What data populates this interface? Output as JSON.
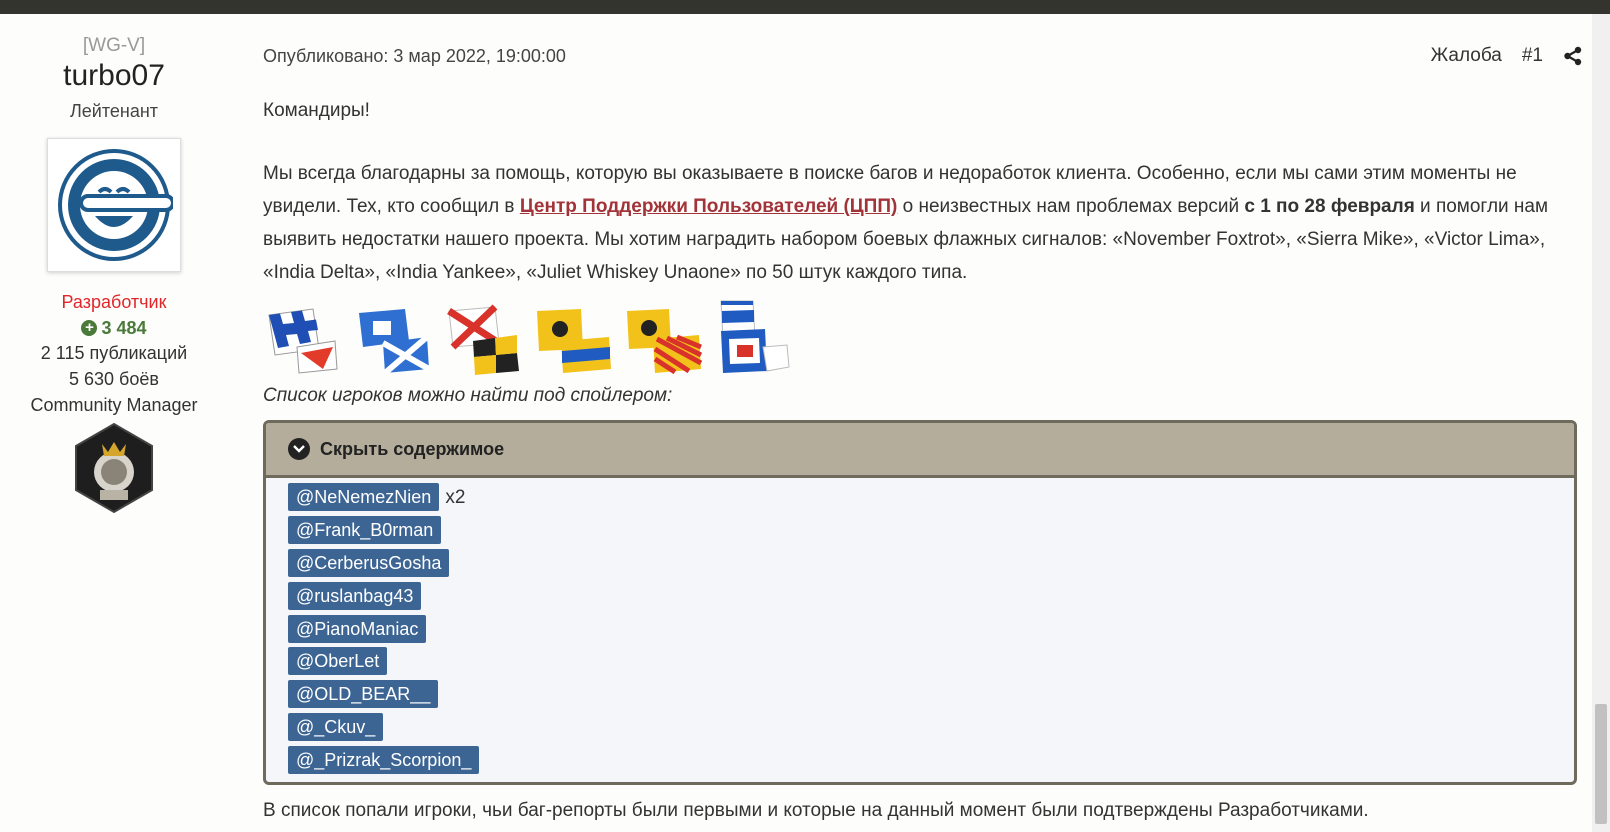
{
  "author": {
    "clan": "[WG-V]",
    "nickname": "turbo07",
    "rank": "Лейтенант",
    "group": "Разработчик",
    "reputation": "3 484",
    "posts": "2 115 публикаций",
    "battles": "5 630 боёв",
    "title": "Community Manager",
    "avatar_icon": "laughing-man-icon",
    "badge_icon": "astronaut-badge-icon"
  },
  "post": {
    "published": "Опубликовано: 3 мар 2022, 19:00:00",
    "report_label": "Жалоба",
    "post_number": "#1",
    "greeting": "Командиры!",
    "paragraph": {
      "part1": "Мы всегда благодарны за помощь, которую вы оказываете в поиске багов и недоработок клиента. Особенно, если мы сами этим моменты не увидели. Тех, кто сообщил в ",
      "link": "Центр Поддержки Пользователей (ЦПП)",
      "part2": " о неизвестных нам проблемах версий ",
      "bold": "с 1 по 28 февраля",
      "part3": " и помогли нам выявить недостатки нашего проекта. Мы хотим наградить набором боевых флажных сигналов: «November Foxtrot», «Sierra Mike», «Victor Lima», «India Delta», «India Yankee», «Juliet Whiskey Unaone» по 50 штук каждого типа."
    },
    "flags": [
      "november-foxtrot-flag-icon",
      "sierra-mike-flag-icon",
      "victor-lima-flag-icon",
      "india-delta-flag-icon",
      "india-yankee-flag-icon",
      "juliet-whiskey-unaone-flag-icon"
    ],
    "spoiler_intro": "Список игроков можно найти под спойлером:",
    "spoiler": {
      "toggle_label": "Скрыть содержимое",
      "mentions": [
        {
          "name": "@NeNemezNien",
          "extra": "x2"
        },
        {
          "name": "@Frank_B0rman",
          "extra": ""
        },
        {
          "name": "@CerberusGosha",
          "extra": ""
        },
        {
          "name": "@ruslanbag43",
          "extra": ""
        },
        {
          "name": "@PianoManiac",
          "extra": ""
        },
        {
          "name": "@OberLet",
          "extra": ""
        },
        {
          "name": "@OLD_BEAR__",
          "extra": ""
        },
        {
          "name": "@_Ckuv_",
          "extra": ""
        },
        {
          "name": "@_Prizrak_Scorpion_",
          "extra": ""
        }
      ]
    },
    "below_text": "В список попали игроки, чьи баг-репорты были первыми и которые на данный момент были подтверждены Разработчиками."
  },
  "colors": {
    "developer_red": "#e0262a",
    "reputation_green": "#4a7a3a",
    "link_red": "#a23339",
    "mention_blue": "#3d6594",
    "spoiler_header": "#b4ad9b"
  }
}
